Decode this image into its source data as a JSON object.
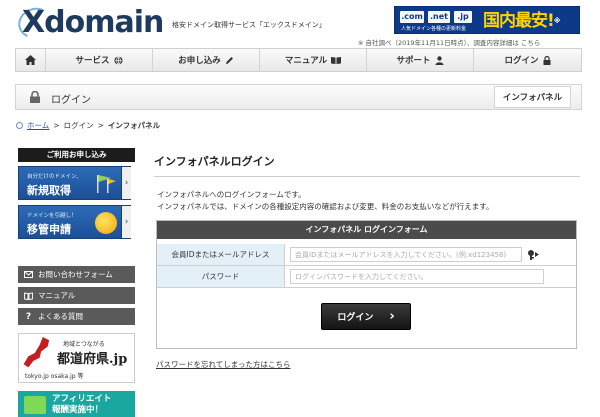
{
  "header": {
    "logo_text": "Xdomain",
    "tagline": "格安ドメイン取得サービス「エックスドメイン」",
    "banner": {
      "tlds": [
        ".com",
        ".net",
        ".jp"
      ],
      "subtext": "人気ドメイン各種の更新料金",
      "headline": "国内最安!",
      "headline_mark": "※"
    },
    "banner_note": "※ 自社調べ（2019年11月11日時点）、調査内容詳細は こちら"
  },
  "nav": {
    "items": [
      {
        "label": "",
        "icon": "home-icon"
      },
      {
        "label": "サービス",
        "icon": "globe-icon"
      },
      {
        "label": "お申し込み",
        "icon": "pencil-icon"
      },
      {
        "label": "マニュアル",
        "icon": "book-icon"
      },
      {
        "label": "サポート",
        "icon": "person-icon"
      },
      {
        "label": "ログイン",
        "icon": "lock-icon"
      }
    ]
  },
  "titlebar": {
    "title": "ログイン",
    "button": "インフォパネル"
  },
  "breadcrumb": {
    "home": "ホーム",
    "sep": ">",
    "login": "ログイン",
    "current": "インフォパネル"
  },
  "sidebar": {
    "heading": "ご利用お申し込み",
    "banners": [
      {
        "small": "自分だけのドメイン、",
        "big": "新規取得"
      },
      {
        "small": "ドメインを引越し！",
        "big": "移管申請"
      }
    ],
    "links": [
      {
        "label": "お問い合わせフォーム",
        "icon": "mail-icon"
      },
      {
        "label": "マニュアル",
        "icon": "book-icon"
      },
      {
        "label": "よくある質問",
        "icon": "question-icon"
      }
    ],
    "pref_banner": {
      "small": "地域とつながる",
      "big": "都道府県.jp",
      "domains": "tokyo.jp osaka.jp 等"
    },
    "aff_banner": {
      "line1": "アフィリエイト",
      "line2": "報酬実施中！"
    }
  },
  "main": {
    "title": "インフォパネルログイン",
    "intro_line1": "インフォパネルへのログインフォームです。",
    "intro_line2": "インフォパネルでは、ドメインの各種設定内容の確認および変更、料金のお支払いなどが行えます。",
    "form": {
      "heading": "インフォパネル ログインフォーム",
      "id_label": "会員IDまたはメールアドレス",
      "id_placeholder": "会員IDまたはメールアドレスを入力してください。(例:xd123456)",
      "password_label": "パスワード",
      "password_placeholder": "ログインパスワードを入力してください。",
      "submit_label": "ログイン",
      "submit_arrow": "›"
    },
    "forgot_link": "パスワードを忘れてしまった方はこちら"
  },
  "colors": {
    "brand_navy": "#1e3a5f",
    "banner_blue": "#0d3a88",
    "banner_yellow": "#ffd200",
    "form_head": "#4b4b4b",
    "label_bg": "#e4f0f8",
    "sidebar_link": "#5a5a5a",
    "link_blue": "#2a4d9b"
  }
}
